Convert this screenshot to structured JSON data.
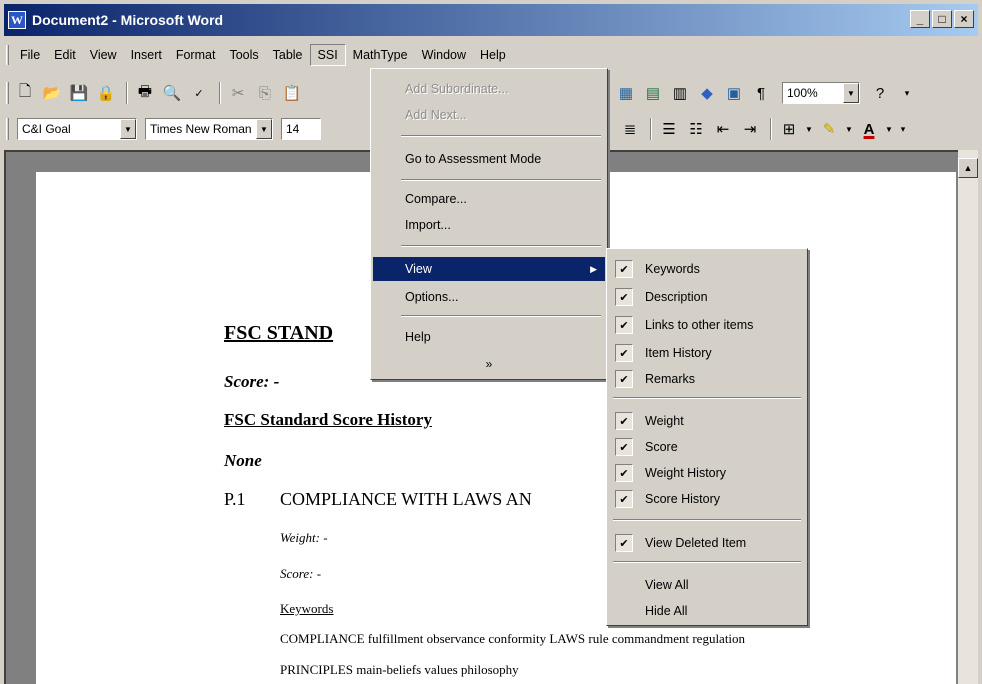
{
  "window": {
    "title": "Document2 - Microsoft Word",
    "minimize": "_",
    "maximize": "□",
    "close": "×"
  },
  "menubar": {
    "items": [
      "File",
      "Edit",
      "View",
      "Insert",
      "Format",
      "Tools",
      "Table",
      "SSI",
      "MathType",
      "Window",
      "Help"
    ]
  },
  "toolbar": {
    "style": "C&I Goal",
    "font": "Times New Roman",
    "size": "14",
    "zoom": "100%"
  },
  "ssi_menu": {
    "items": {
      "add_subordinate": "Add Subordinate...",
      "add_next": "Add Next...",
      "assessment": "Go to Assessment Mode",
      "compare": "Compare...",
      "import": "Import...",
      "view": "View",
      "options": "Options...",
      "help": "Help"
    },
    "more": "»"
  },
  "view_menu": {
    "items": [
      "Keywords",
      "Description",
      "Links to other items",
      "Item History",
      "Remarks",
      "Weight",
      "Score",
      "Weight History",
      "Score History",
      "View Deleted Item",
      "View All",
      "Hide All"
    ]
  },
  "document": {
    "heading": "FSC STAND",
    "score": "Score: -",
    "history_heading": "FSC Standard Score History",
    "none": "None",
    "p1_number": "P.1",
    "p1_title": "COMPLIANCE WITH LAWS AN",
    "weight": "Weight: -",
    "score_item": "Score: -",
    "keywords_label": "Keywords",
    "keywords_line1": "COMPLIANCE fulfillment observance conformity LAWS rule commandment regulation",
    "keywords_line2": "PRINCIPLES main-beliefs values philosophy"
  }
}
